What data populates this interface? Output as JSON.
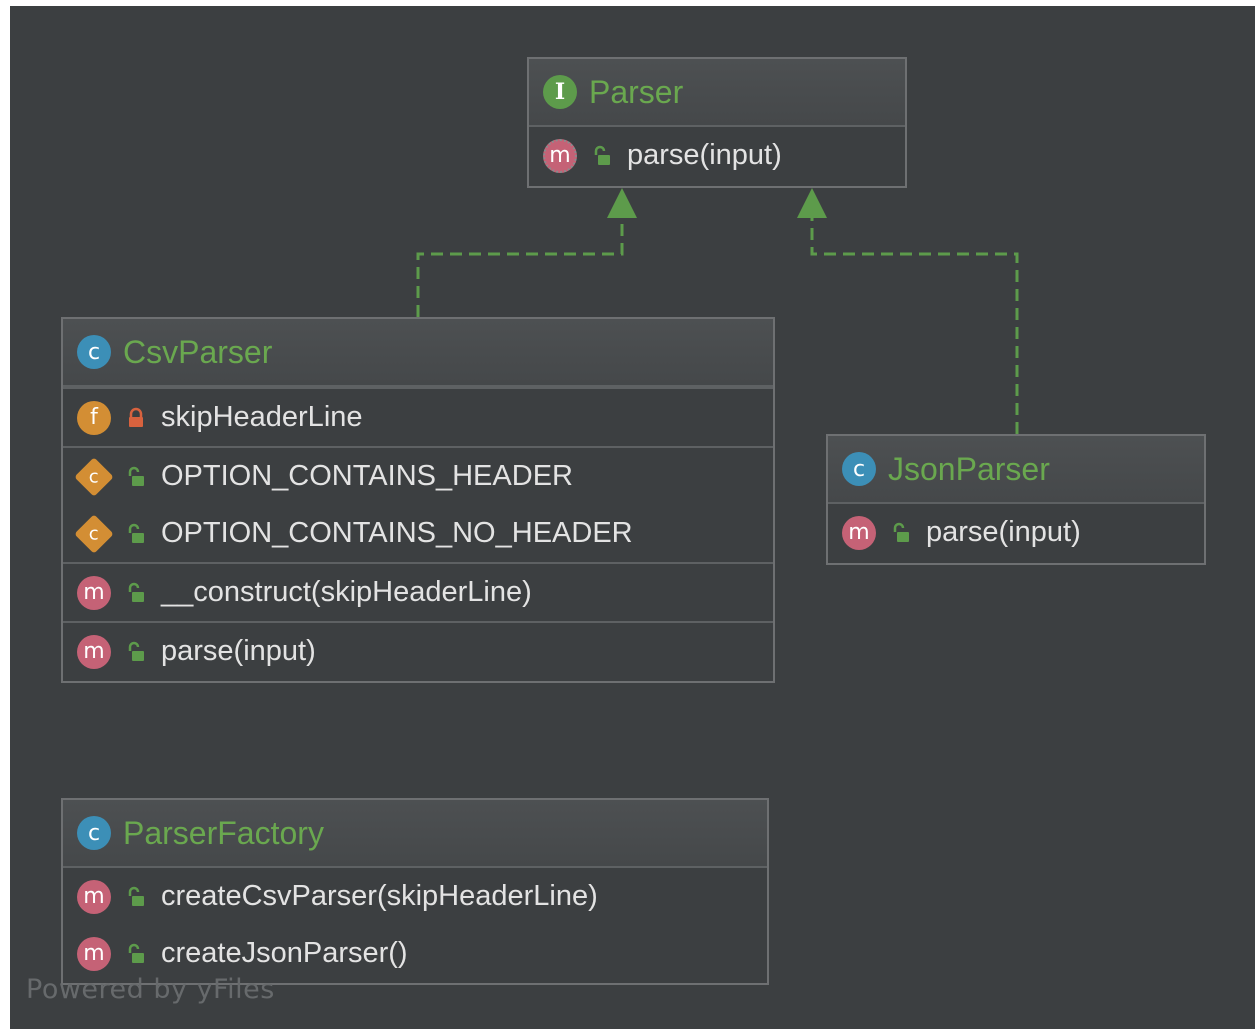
{
  "nodes": {
    "parser": {
      "name": "Parser",
      "kind_icon": "interface-icon",
      "kind_letter": "I",
      "methods": [
        {
          "label": "parse(input)",
          "icon": "abstract-method-icon",
          "letter": "m",
          "visibility": "public"
        }
      ]
    },
    "csv_parser": {
      "name": "CsvParser",
      "kind_icon": "class-icon",
      "kind_letter": "c",
      "fields": [
        {
          "label": "skipHeaderLine",
          "icon": "field-icon",
          "letter": "f",
          "visibility": "private"
        }
      ],
      "constants": [
        {
          "label": "OPTION_CONTAINS_HEADER",
          "icon": "constant-icon",
          "letter": "c",
          "visibility": "public"
        },
        {
          "label": "OPTION_CONTAINS_NO_HEADER",
          "icon": "constant-icon",
          "letter": "c",
          "visibility": "public"
        }
      ],
      "constructor": {
        "label": "__construct(skipHeaderLine)",
        "icon": "method-icon",
        "letter": "m",
        "visibility": "public"
      },
      "methods": [
        {
          "label": "parse(input)",
          "icon": "method-icon",
          "letter": "m",
          "visibility": "public"
        }
      ]
    },
    "json_parser": {
      "name": "JsonParser",
      "kind_icon": "class-icon",
      "kind_letter": "c",
      "methods": [
        {
          "label": "parse(input)",
          "icon": "method-icon",
          "letter": "m",
          "visibility": "public"
        }
      ]
    },
    "parser_factory": {
      "name": "ParserFactory",
      "kind_icon": "class-icon",
      "kind_letter": "c",
      "methods": [
        {
          "label": "createCsvParser(skipHeaderLine)",
          "icon": "method-icon",
          "letter": "m",
          "visibility": "public"
        },
        {
          "label": "createJsonParser()",
          "icon": "method-icon",
          "letter": "m",
          "visibility": "public"
        }
      ]
    }
  },
  "edges": [
    {
      "from": "CsvParser",
      "to": "Parser",
      "type": "implements",
      "style": "dashed"
    },
    {
      "from": "JsonParser",
      "to": "Parser",
      "type": "implements",
      "style": "dashed"
    }
  ],
  "colors": {
    "background": "#3c3f41",
    "title_text": "#6aa84f",
    "member_text": "#e3e3e3",
    "edge": "#5d9b4b",
    "border": "#6e7072"
  },
  "watermark": "Powered by yFiles"
}
